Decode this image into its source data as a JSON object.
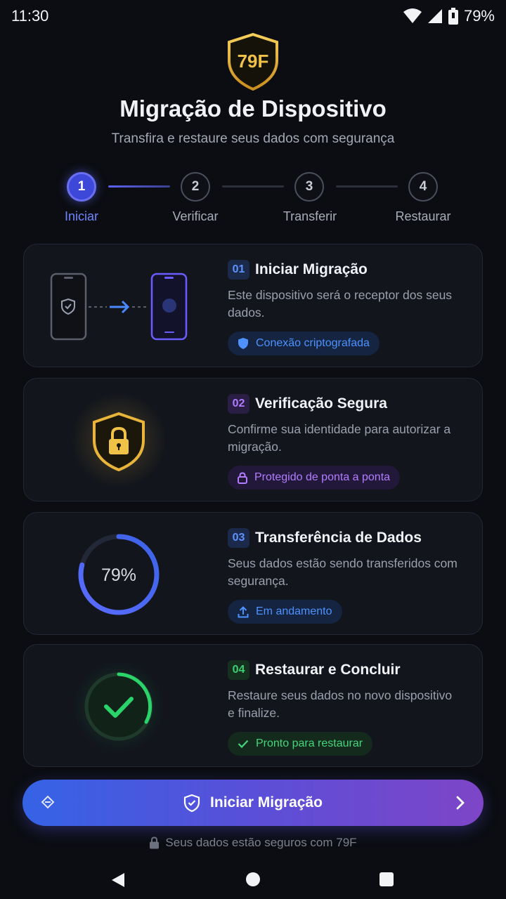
{
  "status": {
    "time": "11:30",
    "battery": "79%"
  },
  "header": {
    "logo_text": "79F",
    "title": "Migração de Dispositivo",
    "subtitle": "Transfira e restaure seus dados com segurança"
  },
  "stepper": [
    {
      "number": "1",
      "label": "Iniciar",
      "active": true
    },
    {
      "number": "2",
      "label": "Verificar",
      "active": false
    },
    {
      "number": "3",
      "label": "Transferir",
      "active": false
    },
    {
      "number": "4",
      "label": "Restaurar",
      "active": false
    }
  ],
  "cards": [
    {
      "number": "01",
      "title": "Iniciar Migração",
      "description": "Este dispositivo será o receptor dos seus dados.",
      "pill": "Conexão criptografada",
      "accent": "#3b82f6"
    },
    {
      "number": "02",
      "title": "Verificação Segura",
      "description": "Confirme sua identidade para autorizar a migração.",
      "pill": "Protegido de ponta a ponta",
      "accent": "#a855f7"
    },
    {
      "number": "03",
      "title": "Transferência de Dados",
      "description": "Seus dados estão sendo transferidos com segurança.",
      "pill": "Em andamento",
      "accent": "#3b82f6",
      "progress_label": "79%",
      "progress": 0.79
    },
    {
      "number": "04",
      "title": "Restaurar e Concluir",
      "description": "Restaure seus dados no novo dispositivo e finalize.",
      "pill": "Pronto para restaurar",
      "accent": "#22c55e"
    }
  ],
  "cta": {
    "label": "Iniciar Migração"
  },
  "footer": {
    "note": "Seus dados estão seguros com 79F"
  },
  "colors": {
    "background": "#0b0d12",
    "card": "#12151c",
    "brand_gold": "#e8b53a",
    "primary_blue": "#3b82f6",
    "purple": "#a855f7",
    "green": "#22c55e"
  }
}
